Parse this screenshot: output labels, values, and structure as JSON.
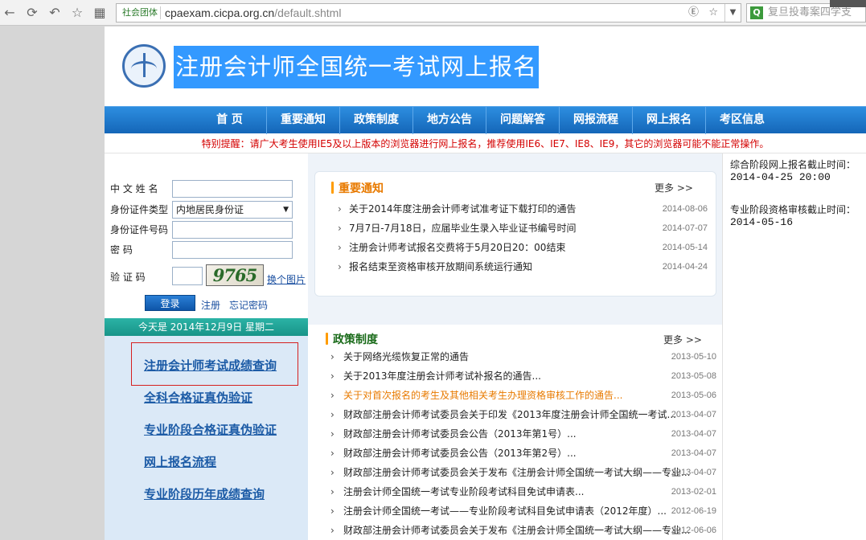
{
  "browser": {
    "address_tag": "社会团体",
    "url_host": "cpaexam.cicpa.org.cn",
    "url_path": "/default.shtml",
    "search_placeholder": "复旦投毒案四学支"
  },
  "header": {
    "site_title": "注册会计师全国统一考试网上报名"
  },
  "nav": {
    "items": [
      "首 页",
      "重要通知",
      "政策制度",
      "地方公告",
      "问题解答",
      "网报流程",
      "网上报名",
      "考区信息"
    ]
  },
  "notice": {
    "text": "特别提醒：请广大考生使用IE5及以上版本的浏览器进行网上报名，推荐使用IE6、IE7、IE8、IE9，其它的浏览器可能不能正常操作。"
  },
  "login": {
    "name_label": "中 文  姓 名",
    "id_type_label": "身份证件类型",
    "id_type_value": "内地居民身份证",
    "id_no_label": "身份证件号码",
    "password_label": "密         码",
    "captcha_label": "验   证   码",
    "captcha_text": "9765",
    "captcha_refresh": "换个图片",
    "login_button": "登录",
    "register_link": "注册",
    "forgot_link": "忘记密码"
  },
  "date_bar": "今天是 2014年12月9日 星期二",
  "quick_links": [
    "注册会计师考试成绩查询",
    "全科合格证真伪验证",
    "专业阶段合格证真伪验证",
    "网上报名流程",
    "专业阶段历年成绩查询"
  ],
  "important": {
    "title": "重要通知",
    "more": "更多 >>",
    "items": [
      {
        "title": "关于2014年度注册会计师考试准考证下载打印的通告",
        "date": "2014-08-06"
      },
      {
        "title": "7月7日-7月18日，应届毕业生录入毕业证书编号时间",
        "date": "2014-07-07"
      },
      {
        "title": "注册会计师考试报名交费将于5月20日20：00结束",
        "date": "2014-05-14"
      },
      {
        "title": "报名结束至资格审核开放期间系统运行通知",
        "date": "2014-04-24"
      }
    ]
  },
  "policy": {
    "title": "政策制度",
    "more": "更多 >>",
    "items": [
      {
        "title": "关于网络光缆恢复正常的通告",
        "date": "2013-05-10"
      },
      {
        "title": "关于2013年度注册会计师考试补报名的通告...",
        "date": "2013-05-08"
      },
      {
        "title": "关于对首次报名的考生及其他相关考生办理资格审核工作的通告...",
        "date": "2013-05-06"
      },
      {
        "title": "财政部注册会计师考试委员会关于印发《2013年度注册会计师全国统一考试...",
        "date": "2013-04-07"
      },
      {
        "title": "财政部注册会计师考试委员会公告（2013年第1号）...",
        "date": "2013-04-07"
      },
      {
        "title": "财政部注册会计师考试委员会公告（2013年第2号）...",
        "date": "2013-04-07"
      },
      {
        "title": "财政部注册会计师考试委员会关于发布《注册会计师全国统一考试大纲——专业...",
        "date": "2013-04-07"
      },
      {
        "title": "注册会计师全国统一考试专业阶段考试科目免试申请表...",
        "date": "2013-02-01"
      },
      {
        "title": "注册会计师全国统一考试——专业阶段考试科目免试申请表（2012年度）...",
        "date": "2012-06-19"
      },
      {
        "title": "财政部注册会计师考试委员会关于发布《注册会计师全国统一考试大纲——专业...",
        "date": "2012-06-06"
      }
    ]
  },
  "deadlines": [
    {
      "label": "综合阶段网上报名截止时间：",
      "value": "2014-04-25 20:00"
    },
    {
      "label": "专业阶段资格审核截止时间：",
      "value": "2014-05-16"
    }
  ],
  "colors": {
    "nav_blue": "#1466b8",
    "title_highlight": "#3399ff",
    "notice_red": "#d40000",
    "section_orange": "#e87a00",
    "link_blue": "#1c5ba6",
    "date_bar_teal": "#189488"
  }
}
